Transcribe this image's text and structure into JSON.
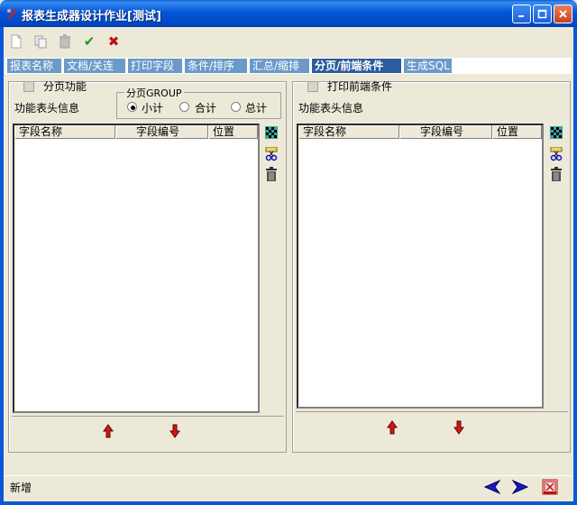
{
  "window": {
    "title": "报表生成器设计作业[测试]",
    "controls": [
      "_",
      "□",
      "X"
    ]
  },
  "toolbar": {
    "new_icon": "new-icon",
    "copy_icon": "copy-icon",
    "delete_icon": "trash-icon",
    "confirm_symbol": "✔",
    "cancel_symbol": "✖"
  },
  "tabs": [
    {
      "label": "报表名称"
    },
    {
      "label": "文档/关连"
    },
    {
      "label": "打印字段"
    },
    {
      "label": "条件/排序"
    },
    {
      "label": "汇总/缩排"
    },
    {
      "label": "分页/前端条件",
      "active": true
    },
    {
      "label": "生成SQL"
    }
  ],
  "left_panel": {
    "checkbox_label": "分页功能",
    "info_label": "功能表头信息",
    "group_box": {
      "title": "分页GROUP",
      "options": [
        "小计",
        "合计",
        "总计"
      ],
      "selected": "小计"
    },
    "columns": [
      "字段名称",
      "字段编号",
      "位置"
    ]
  },
  "right_panel": {
    "checkbox_label": "打印前端条件",
    "info_label": "功能表头信息",
    "columns": [
      "字段名称",
      "字段编号",
      "位置"
    ]
  },
  "status": {
    "mode": "新增"
  },
  "colors": {
    "titlebar": "#0256D8",
    "tab_inactive": "#6A9AC8",
    "tab_active": "#2C5C9C",
    "face": "#ECE9D8",
    "arrow_red": "#D01818"
  }
}
